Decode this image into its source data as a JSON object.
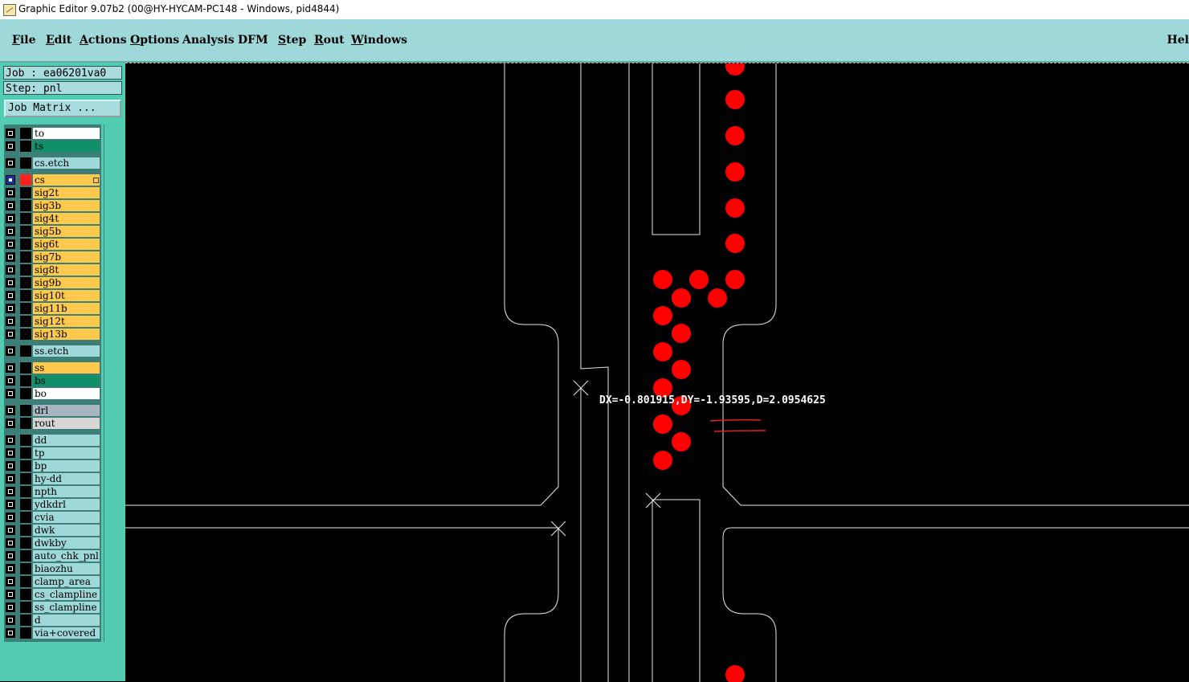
{
  "window": {
    "title": "Graphic Editor 9.07b2 (00@HY-HYCAM-PC148 - Windows, pid4844)"
  },
  "menu": {
    "items": [
      "File",
      "Edit",
      "Actions",
      "Options",
      "Analysis",
      "DFM",
      "Step",
      "Rout",
      "Windows"
    ],
    "help": "Hel"
  },
  "panel": {
    "job": "Job : ea06201va0",
    "step": "Step: pnl",
    "job_matrix": "Job Matrix ..."
  },
  "layers": [
    {
      "name": "to",
      "color": "white"
    },
    {
      "name": "ts",
      "color": "green"
    },
    {
      "name": "cs.etch",
      "color": "cyan"
    },
    {
      "name": "cs",
      "color": "orange",
      "active": true
    },
    {
      "name": "sig2t",
      "color": "orange"
    },
    {
      "name": "sig3b",
      "color": "orange"
    },
    {
      "name": "sig4t",
      "color": "orange"
    },
    {
      "name": "sig5b",
      "color": "orange"
    },
    {
      "name": "sig6t",
      "color": "orange"
    },
    {
      "name": "sig7b",
      "color": "orange"
    },
    {
      "name": "sig8t",
      "color": "orange"
    },
    {
      "name": "sig9b",
      "color": "orange"
    },
    {
      "name": "sig10t",
      "color": "orange"
    },
    {
      "name": "sig11b",
      "color": "orange"
    },
    {
      "name": "sig12t",
      "color": "orange"
    },
    {
      "name": "sig13b",
      "color": "orange"
    },
    {
      "name": "ss.etch",
      "color": "cyan"
    },
    {
      "name": "ss",
      "color": "orange"
    },
    {
      "name": "bs",
      "color": "green"
    },
    {
      "name": "bo",
      "color": "white"
    },
    {
      "name": "drl",
      "color": "gray"
    },
    {
      "name": "rout",
      "color": "lgray"
    },
    {
      "name": "dd",
      "color": "cyan"
    },
    {
      "name": "tp",
      "color": "cyan"
    },
    {
      "name": "bp",
      "color": "cyan"
    },
    {
      "name": "hy-dd",
      "color": "cyan"
    },
    {
      "name": "npth",
      "color": "cyan"
    },
    {
      "name": "ydkdrl",
      "color": "cyan"
    },
    {
      "name": "cvia",
      "color": "cyan"
    },
    {
      "name": "dwk",
      "color": "cyan"
    },
    {
      "name": "dwkby",
      "color": "cyan"
    },
    {
      "name": "auto_chk_pnl",
      "color": "cyan"
    },
    {
      "name": "biaozhu",
      "color": "cyan"
    },
    {
      "name": "clamp_area",
      "color": "cyan"
    },
    {
      "name": "cs_clampline",
      "color": "cyan"
    },
    {
      "name": "ss_clampline",
      "color": "cyan"
    },
    {
      "name": "d",
      "color": "cyan"
    },
    {
      "name": "via+covered",
      "color": "cyan"
    }
  ],
  "canvas": {
    "measurement": "DX=-0.801915,DY=-1.93595,D=2.0954625"
  },
  "colors": {
    "menubar": "#9fd8d9",
    "panel": "#52ccb0",
    "pad": "#ff0000",
    "annotation": "#e02020"
  }
}
